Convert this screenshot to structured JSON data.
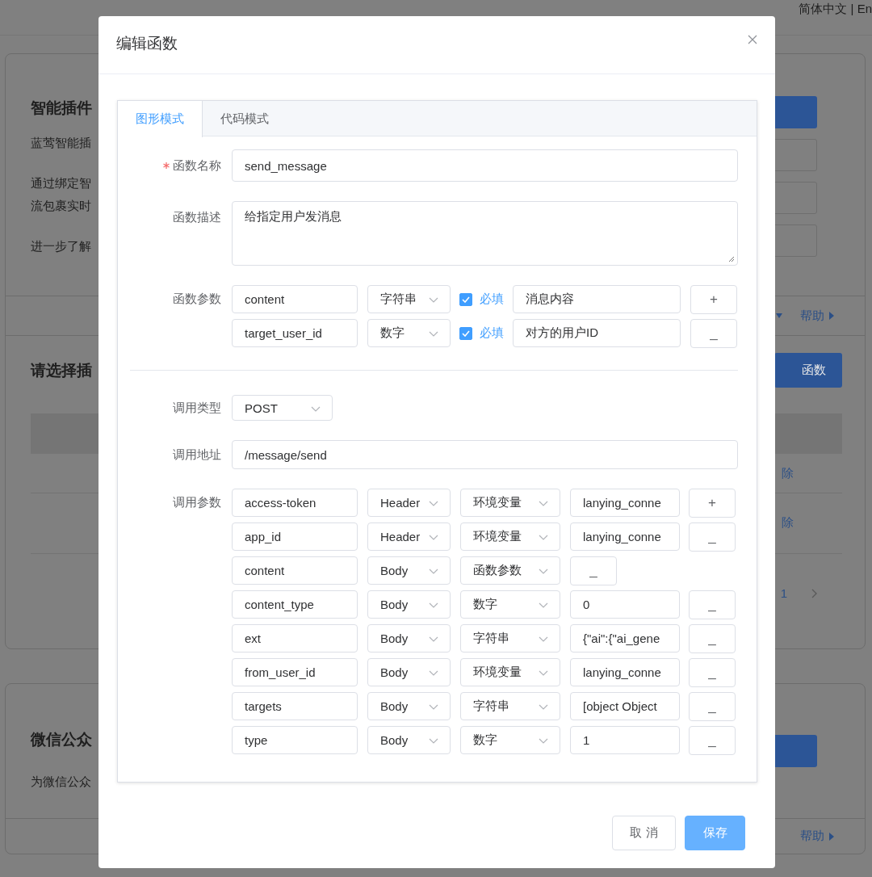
{
  "background_page": {
    "language_switch": "简体中文 | En",
    "plugin_card": {
      "title": "智能插件",
      "paragraphs": [
        [
          "蓝莺智能插"
        ],
        [
          "通过绑定智",
          "流包裹实时"
        ],
        [
          "进一步了解"
        ]
      ],
      "help_link": "帮助"
    },
    "plugin_list": {
      "title": "请选择插",
      "add_button": "函数",
      "rows": [
        {
          "action": "除"
        },
        {
          "action": "除"
        }
      ],
      "pagination": {
        "page": "1"
      }
    },
    "wechat_card": {
      "title": "微信公众",
      "description": "为微信公众",
      "help_link": "帮助"
    }
  },
  "dialog": {
    "title": "编辑函数",
    "tabs": [
      {
        "label": "图形模式",
        "selected": true
      },
      {
        "label": "代码模式",
        "selected": false
      }
    ],
    "name": {
      "label": "函数名称",
      "required": true,
      "value": "send_message"
    },
    "description": {
      "label": "函数描述",
      "value": "给指定用户发消息"
    },
    "params": {
      "label": "函数参数",
      "rows": [
        {
          "name": "content",
          "type": "字符串",
          "required": true,
          "required_label": "必填",
          "description": "消息内容",
          "action": "+"
        },
        {
          "name": "target_user_id",
          "type": "数字",
          "required": true,
          "required_label": "必填",
          "description": "对方的用户ID",
          "action": "_"
        }
      ]
    },
    "call_type": {
      "label": "调用类型",
      "value": "POST"
    },
    "call_url": {
      "label": "调用地址",
      "value": "/message/send"
    },
    "call_params": {
      "label": "调用参数",
      "rows": [
        {
          "name": "access-token",
          "location": "Header",
          "source": "环境变量",
          "value": "lanying_conne",
          "action": "+"
        },
        {
          "name": "app_id",
          "location": "Header",
          "source": "环境变量",
          "value": "lanying_conne",
          "action": "_"
        },
        {
          "name": "content",
          "location": "Body",
          "source": "函数参数",
          "action": "_"
        },
        {
          "name": "content_type",
          "location": "Body",
          "source": "数字",
          "value": "0",
          "action": "_"
        },
        {
          "name": "ext",
          "location": "Body",
          "source": "字符串",
          "value": "{\"ai\":{\"ai_gene",
          "action": "_"
        },
        {
          "name": "from_user_id",
          "location": "Body",
          "source": "环境变量",
          "value": "lanying_conne",
          "action": "_"
        },
        {
          "name": "targets",
          "location": "Body",
          "source": "字符串",
          "value": "[object Object",
          "action": "_"
        },
        {
          "name": "type",
          "location": "Body",
          "source": "数字",
          "value": "1",
          "action": "_"
        }
      ]
    },
    "buttons": [
      {
        "label": "取 消",
        "kind": "default"
      },
      {
        "label": "保存",
        "kind": "primary"
      }
    ]
  }
}
